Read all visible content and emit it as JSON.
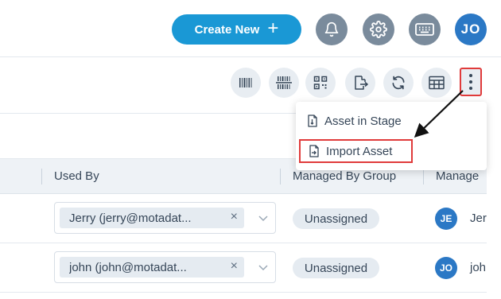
{
  "header": {
    "create_label": "Create New",
    "avatar_initials": "JO"
  },
  "menu": {
    "items": [
      {
        "label": "Asset in Stage"
      },
      {
        "label": "Import Asset"
      }
    ]
  },
  "table": {
    "columns": [
      "Used By",
      "Managed By Group",
      "Manage"
    ],
    "rows": [
      {
        "used_by": "Jerry (jerry@motadat...",
        "group": "Unassigned",
        "manager_initials": "JE",
        "manager": "Jer"
      },
      {
        "used_by": "john (john@motadat...",
        "group": "Unassigned",
        "manager_initials": "JO",
        "manager": "joh"
      }
    ]
  },
  "colors": {
    "accent": "#1a98d5",
    "avatar": "#2b78c5",
    "highlight": "#e03b3b"
  }
}
